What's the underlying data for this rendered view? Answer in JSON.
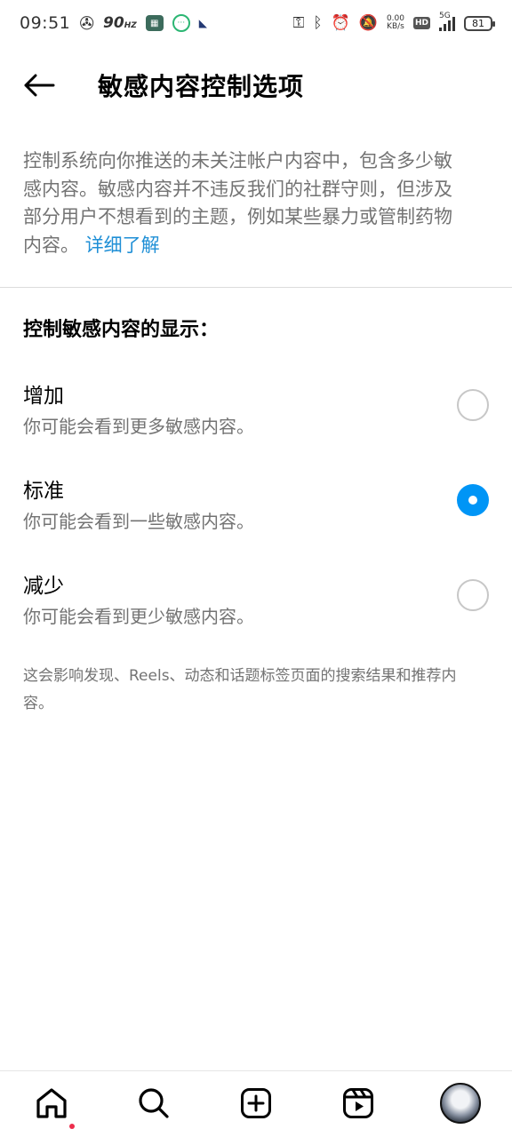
{
  "status_bar": {
    "time": "09:51",
    "refresh_rate": "90",
    "refresh_unit": "HZ",
    "net_speed_value": "0.00",
    "net_speed_unit": "KB/s",
    "hd_badge": "HD",
    "network_type": "5G",
    "battery": "81",
    "icons": [
      "fan-icon",
      "app-icon",
      "chat-icon",
      "cat-icon",
      "key-icon",
      "bluetooth-icon",
      "alarm-icon",
      "mute-icon",
      "signal-icon",
      "battery-icon"
    ]
  },
  "header": {
    "back_icon": "back-arrow-icon",
    "title": "敏感内容控制选项"
  },
  "description": {
    "text": "控制系统向你推送的未关注帐户内容中，包含多少敏感内容。敏感内容并不违反我们的社群守则，但涉及部分用户不想看到的主题，例如某些暴力或管制药物内容。",
    "link": "详细了解"
  },
  "section_title": "控制敏感内容的显示：",
  "options": [
    {
      "label": "增加",
      "description": "你可能会看到更多敏感内容。",
      "selected": false
    },
    {
      "label": "标准",
      "description": "你可能会看到一些敏感内容。",
      "selected": true
    },
    {
      "label": "减少",
      "description": "你可能会看到更少敏感内容。",
      "selected": false
    }
  ],
  "footnote": "这会影响发现、Reels、动态和话题标签页面的搜索结果和推荐内容。",
  "bottom_nav": {
    "items": [
      "home-icon",
      "search-icon",
      "create-icon",
      "reels-icon",
      "profile-avatar"
    ],
    "active": "home-icon",
    "notification_dot_color": "#ed2d4c"
  },
  "colors": {
    "accent": "#0095f6",
    "link": "#1f8fd6",
    "secondary_text": "#737373"
  }
}
